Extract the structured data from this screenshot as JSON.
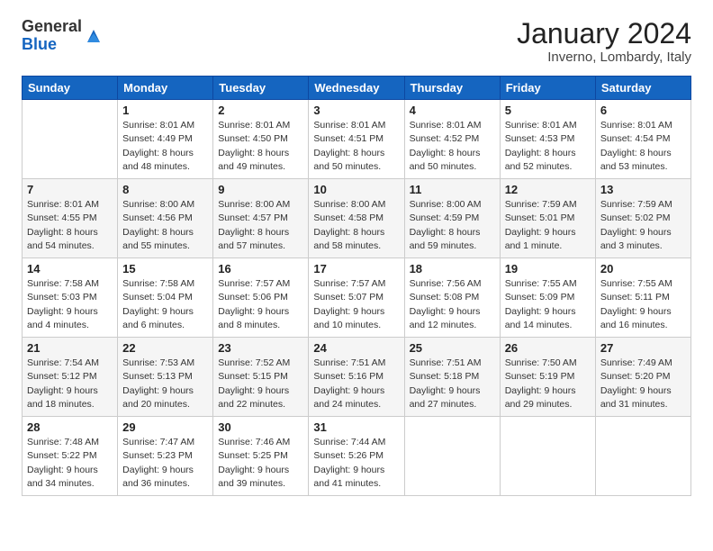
{
  "logo": {
    "general": "General",
    "blue": "Blue"
  },
  "header": {
    "title": "January 2024",
    "location": "Inverno, Lombardy, Italy"
  },
  "weekdays": [
    "Sunday",
    "Monday",
    "Tuesday",
    "Wednesday",
    "Thursday",
    "Friday",
    "Saturday"
  ],
  "weeks": [
    [
      {
        "day": "",
        "info": ""
      },
      {
        "day": "1",
        "info": "Sunrise: 8:01 AM\nSunset: 4:49 PM\nDaylight: 8 hours\nand 48 minutes."
      },
      {
        "day": "2",
        "info": "Sunrise: 8:01 AM\nSunset: 4:50 PM\nDaylight: 8 hours\nand 49 minutes."
      },
      {
        "day": "3",
        "info": "Sunrise: 8:01 AM\nSunset: 4:51 PM\nDaylight: 8 hours\nand 50 minutes."
      },
      {
        "day": "4",
        "info": "Sunrise: 8:01 AM\nSunset: 4:52 PM\nDaylight: 8 hours\nand 50 minutes."
      },
      {
        "day": "5",
        "info": "Sunrise: 8:01 AM\nSunset: 4:53 PM\nDaylight: 8 hours\nand 52 minutes."
      },
      {
        "day": "6",
        "info": "Sunrise: 8:01 AM\nSunset: 4:54 PM\nDaylight: 8 hours\nand 53 minutes."
      }
    ],
    [
      {
        "day": "7",
        "info": "Sunrise: 8:01 AM\nSunset: 4:55 PM\nDaylight: 8 hours\nand 54 minutes."
      },
      {
        "day": "8",
        "info": "Sunrise: 8:00 AM\nSunset: 4:56 PM\nDaylight: 8 hours\nand 55 minutes."
      },
      {
        "day": "9",
        "info": "Sunrise: 8:00 AM\nSunset: 4:57 PM\nDaylight: 8 hours\nand 57 minutes."
      },
      {
        "day": "10",
        "info": "Sunrise: 8:00 AM\nSunset: 4:58 PM\nDaylight: 8 hours\nand 58 minutes."
      },
      {
        "day": "11",
        "info": "Sunrise: 8:00 AM\nSunset: 4:59 PM\nDaylight: 8 hours\nand 59 minutes."
      },
      {
        "day": "12",
        "info": "Sunrise: 7:59 AM\nSunset: 5:01 PM\nDaylight: 9 hours\nand 1 minute."
      },
      {
        "day": "13",
        "info": "Sunrise: 7:59 AM\nSunset: 5:02 PM\nDaylight: 9 hours\nand 3 minutes."
      }
    ],
    [
      {
        "day": "14",
        "info": "Sunrise: 7:58 AM\nSunset: 5:03 PM\nDaylight: 9 hours\nand 4 minutes."
      },
      {
        "day": "15",
        "info": "Sunrise: 7:58 AM\nSunset: 5:04 PM\nDaylight: 9 hours\nand 6 minutes."
      },
      {
        "day": "16",
        "info": "Sunrise: 7:57 AM\nSunset: 5:06 PM\nDaylight: 9 hours\nand 8 minutes."
      },
      {
        "day": "17",
        "info": "Sunrise: 7:57 AM\nSunset: 5:07 PM\nDaylight: 9 hours\nand 10 minutes."
      },
      {
        "day": "18",
        "info": "Sunrise: 7:56 AM\nSunset: 5:08 PM\nDaylight: 9 hours\nand 12 minutes."
      },
      {
        "day": "19",
        "info": "Sunrise: 7:55 AM\nSunset: 5:09 PM\nDaylight: 9 hours\nand 14 minutes."
      },
      {
        "day": "20",
        "info": "Sunrise: 7:55 AM\nSunset: 5:11 PM\nDaylight: 9 hours\nand 16 minutes."
      }
    ],
    [
      {
        "day": "21",
        "info": "Sunrise: 7:54 AM\nSunset: 5:12 PM\nDaylight: 9 hours\nand 18 minutes."
      },
      {
        "day": "22",
        "info": "Sunrise: 7:53 AM\nSunset: 5:13 PM\nDaylight: 9 hours\nand 20 minutes."
      },
      {
        "day": "23",
        "info": "Sunrise: 7:52 AM\nSunset: 5:15 PM\nDaylight: 9 hours\nand 22 minutes."
      },
      {
        "day": "24",
        "info": "Sunrise: 7:51 AM\nSunset: 5:16 PM\nDaylight: 9 hours\nand 24 minutes."
      },
      {
        "day": "25",
        "info": "Sunrise: 7:51 AM\nSunset: 5:18 PM\nDaylight: 9 hours\nand 27 minutes."
      },
      {
        "day": "26",
        "info": "Sunrise: 7:50 AM\nSunset: 5:19 PM\nDaylight: 9 hours\nand 29 minutes."
      },
      {
        "day": "27",
        "info": "Sunrise: 7:49 AM\nSunset: 5:20 PM\nDaylight: 9 hours\nand 31 minutes."
      }
    ],
    [
      {
        "day": "28",
        "info": "Sunrise: 7:48 AM\nSunset: 5:22 PM\nDaylight: 9 hours\nand 34 minutes."
      },
      {
        "day": "29",
        "info": "Sunrise: 7:47 AM\nSunset: 5:23 PM\nDaylight: 9 hours\nand 36 minutes."
      },
      {
        "day": "30",
        "info": "Sunrise: 7:46 AM\nSunset: 5:25 PM\nDaylight: 9 hours\nand 39 minutes."
      },
      {
        "day": "31",
        "info": "Sunrise: 7:44 AM\nSunset: 5:26 PM\nDaylight: 9 hours\nand 41 minutes."
      },
      {
        "day": "",
        "info": ""
      },
      {
        "day": "",
        "info": ""
      },
      {
        "day": "",
        "info": ""
      }
    ]
  ]
}
